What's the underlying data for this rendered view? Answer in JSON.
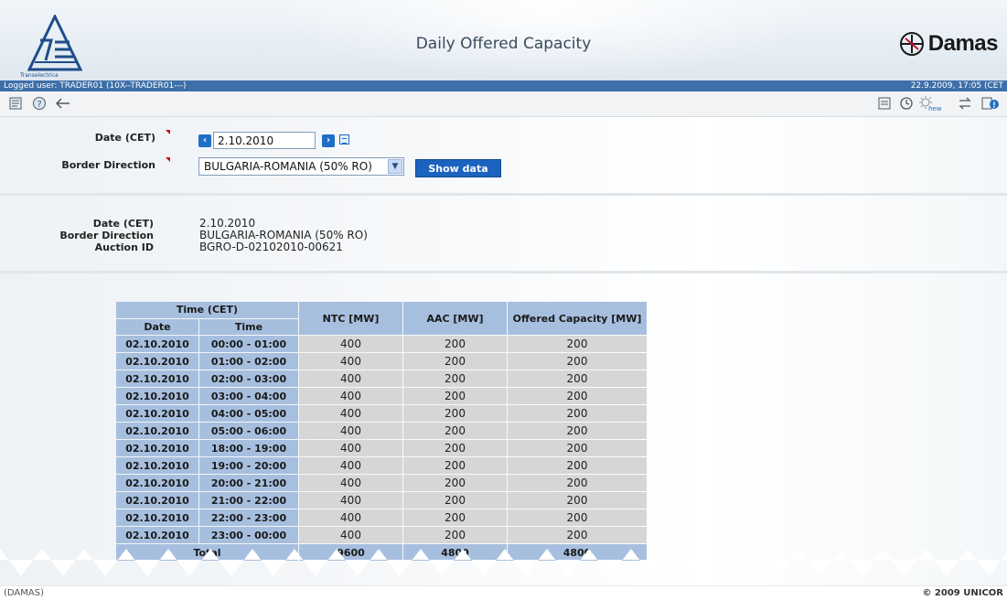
{
  "header": {
    "title": "Daily Offered Capacity",
    "left_logo_text": "Transelectrica",
    "right_logo_text": "Damas"
  },
  "statusbar": {
    "user": "Logged user: TRADER01 (10X--TRADER01---)",
    "datetime": "22.9.2009, 17:05 (CET"
  },
  "toolbar": {
    "left_icons": [
      "report-icon",
      "help-icon",
      "back-icon"
    ],
    "right_icons": [
      "list-icon",
      "clock-icon",
      "new-icon",
      "exchange-icon",
      "notifications-icon"
    ]
  },
  "form": {
    "date_label": "Date (CET)",
    "date_value": "2.10.2010",
    "border_label": "Border Direction",
    "border_value": "BULGARIA-ROMANIA (50% RO)",
    "show_button": "Show data"
  },
  "info": {
    "date_label": "Date (CET)",
    "date_value": "2.10.2010",
    "border_label": "Border Direction",
    "border_value": "BULGARIA-ROMANIA (50% RO)",
    "auction_label": "Auction ID",
    "auction_value": "BGRO-D-02102010-00621"
  },
  "table": {
    "group_header": "Time (CET)",
    "col_date": "Date",
    "col_time": "Time",
    "col_ntc": "NTC [MW]",
    "col_aac": "AAC [MW]",
    "col_offered": "Offered Capacity [MW]",
    "rows_top": [
      {
        "date": "02.10.2010",
        "time": "00:00 - 01:00",
        "ntc": "400",
        "aac": "200",
        "offered": "200"
      },
      {
        "date": "02.10.2010",
        "time": "01:00 - 02:00",
        "ntc": "400",
        "aac": "200",
        "offered": "200"
      },
      {
        "date": "02.10.2010",
        "time": "02:00 - 03:00",
        "ntc": "400",
        "aac": "200",
        "offered": "200"
      },
      {
        "date": "02.10.2010",
        "time": "03:00 - 04:00",
        "ntc": "400",
        "aac": "200",
        "offered": "200"
      },
      {
        "date": "02.10.2010",
        "time": "04:00 - 05:00",
        "ntc": "400",
        "aac": "200",
        "offered": "200"
      },
      {
        "date": "02.10.2010",
        "time": "05:00 - 06:00",
        "ntc": "400",
        "aac": "200",
        "offered": "200"
      }
    ],
    "rows_bottom": [
      {
        "date": "02.10.2010",
        "time": "18:00 - 19:00",
        "ntc": "400",
        "aac": "200",
        "offered": "200"
      },
      {
        "date": "02.10.2010",
        "time": "19:00 - 20:00",
        "ntc": "400",
        "aac": "200",
        "offered": "200"
      },
      {
        "date": "02.10.2010",
        "time": "20:00 - 21:00",
        "ntc": "400",
        "aac": "200",
        "offered": "200"
      },
      {
        "date": "02.10.2010",
        "time": "21:00 - 22:00",
        "ntc": "400",
        "aac": "200",
        "offered": "200"
      },
      {
        "date": "02.10.2010",
        "time": "22:00 - 23:00",
        "ntc": "400",
        "aac": "200",
        "offered": "200"
      },
      {
        "date": "02.10.2010",
        "time": "23:00 - 00:00",
        "ntc": "400",
        "aac": "200",
        "offered": "200"
      }
    ],
    "total_label": "Total",
    "total_ntc": "9600",
    "total_aac": "4800",
    "total_offered": "4800"
  },
  "footer": {
    "left": "(DAMAS)",
    "right": "© 2009 UNICOR"
  },
  "colors": {
    "status_bar": "#3d6fa8",
    "button": "#1b63bf",
    "table_header": "#a7bfdf",
    "table_cell": "#d6d6d6",
    "required_marker": "#d0021b"
  }
}
